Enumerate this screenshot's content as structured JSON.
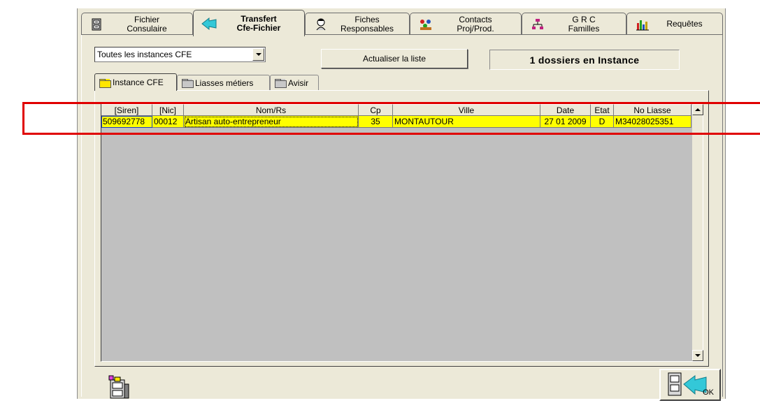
{
  "tabs": [
    {
      "label": "Fichier\nConsulaire",
      "icon": "file-cabinet-icon"
    },
    {
      "label": "Transfert\nCfe-Fichier",
      "icon": "arrow-transfer-icon"
    },
    {
      "label": "Fiches\nResponsables",
      "icon": "person-profile-icon"
    },
    {
      "label": "Contacts\nProj/Prod.",
      "icon": "contacts-icon"
    },
    {
      "label": "G R C\nFamilles",
      "icon": "org-chart-icon"
    },
    {
      "label": "Requêtes",
      "icon": "bar-chart-icon"
    }
  ],
  "filter": {
    "selected": "Toutes les instances CFE"
  },
  "refresh_button": "Actualiser la liste",
  "instance_count": "1 dossiers en Instance",
  "subtabs": [
    {
      "label": "Instance CFE"
    },
    {
      "label": "Liasses métiers"
    },
    {
      "label": "Avisir"
    }
  ],
  "grid": {
    "columns": [
      "[Siren]",
      "[Nic]",
      "Nom/Rs",
      "Cp",
      "Ville",
      "Date",
      "Etat",
      "No Liasse"
    ],
    "rows": [
      [
        "509692778",
        "00012",
        "Artisan auto-entrepreneur",
        "35",
        "MONTAUTOUR",
        "27 01 2009",
        "D",
        "M34028025351"
      ]
    ]
  },
  "ok_button": "OK",
  "colors": {
    "row_highlight": "#ffff00",
    "annotation": "#e00000",
    "window_bg": "#ece9d8"
  }
}
